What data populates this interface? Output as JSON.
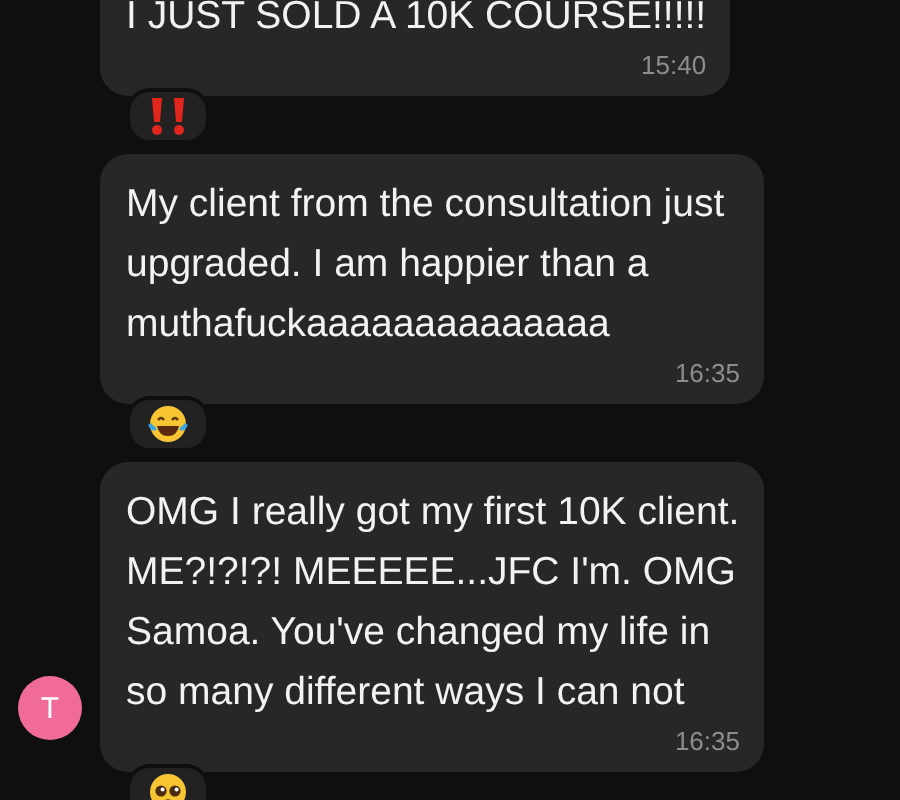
{
  "messages": [
    {
      "text": "I JUST SOLD A 10K COURSE!!!!!",
      "time": "15:40",
      "reaction": {
        "kind": "exclamation"
      }
    },
    {
      "text": "My client from the consultation just upgraded. I am happier than a muthafuckaaaaaaaaaaaaaa",
      "time": "16:35",
      "reaction": {
        "kind": "laughing"
      }
    },
    {
      "text": "OMG I really got my first 10K client. ME?!?!?! MEEEEE...JFC I'm. OMG Samoa. You've changed my life in so many different ways I can not",
      "time": "16:35",
      "reaction": {
        "kind": "pleading"
      },
      "avatar": {
        "initial": "T",
        "color": "#f06a9a"
      }
    }
  ]
}
